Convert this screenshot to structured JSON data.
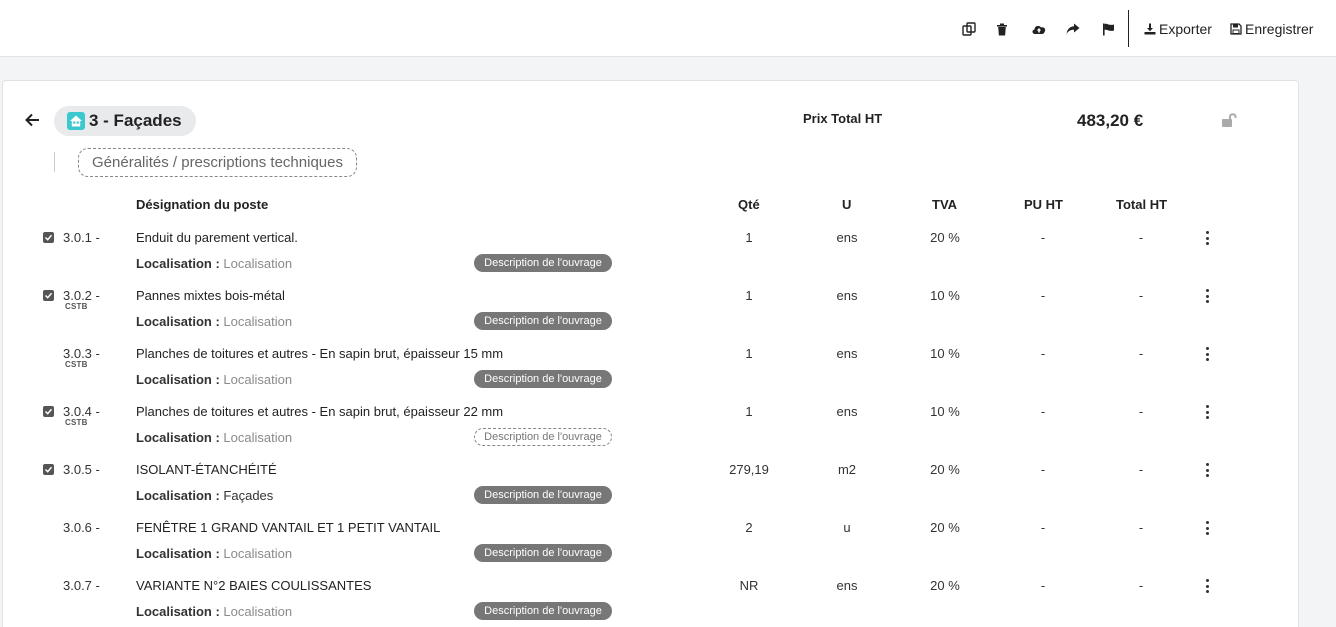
{
  "toolbar": {
    "icons": [
      "duplicate-icon",
      "trash-icon",
      "cloud-upload-icon",
      "share-icon",
      "flag-icon"
    ],
    "export_label": "Exporter",
    "save_label": "Enregistrer"
  },
  "header": {
    "section_title": "3 - Façades",
    "prix_label": "Prix Total HT",
    "prix_value": "483,20 €",
    "generalites_label": "Généralités / prescriptions techniques"
  },
  "table": {
    "headers": {
      "designation": "Désignation du poste",
      "qte": "Qté",
      "u": "U",
      "tva": "TVA",
      "pu_ht": "PU HT",
      "total_ht": "Total HT"
    },
    "localisation_label": "Localisation :",
    "description_label": "Description de l'ouvrage",
    "cstb_label": "CSTB",
    "rows": [
      {
        "num": "3.0.1 -",
        "checked": true,
        "cstb": false,
        "designation": "Enduit du parement vertical.",
        "localisation": "Localisation",
        "loc_filled": false,
        "desc_outline": false,
        "qte": "1",
        "u": "ens",
        "tva": "20 %",
        "pu_ht": "-",
        "total_ht": "-"
      },
      {
        "num": "3.0.2 -",
        "checked": true,
        "cstb": true,
        "designation": "Pannes mixtes bois-métal",
        "localisation": "Localisation",
        "loc_filled": false,
        "desc_outline": false,
        "qte": "1",
        "u": "ens",
        "tva": "10 %",
        "pu_ht": "-",
        "total_ht": "-"
      },
      {
        "num": "3.0.3 -",
        "checked": false,
        "cstb": true,
        "designation": "Planches de toitures et autres - En sapin brut, épaisseur 15 mm",
        "localisation": "Localisation",
        "loc_filled": false,
        "desc_outline": false,
        "qte": "1",
        "u": "ens",
        "tva": "10 %",
        "pu_ht": "-",
        "total_ht": "-"
      },
      {
        "num": "3.0.4 -",
        "checked": true,
        "cstb": true,
        "designation": "Planches de toitures et autres - En sapin brut, épaisseur 22 mm",
        "localisation": "Localisation",
        "loc_filled": false,
        "desc_outline": true,
        "qte": "1",
        "u": "ens",
        "tva": "10 %",
        "pu_ht": "-",
        "total_ht": "-"
      },
      {
        "num": "3.0.5 -",
        "checked": true,
        "cstb": false,
        "designation": "ISOLANT-ÉTANCHÉITÉ",
        "localisation": "Façades",
        "loc_filled": true,
        "desc_outline": false,
        "qte": "279,19",
        "u": "m2",
        "tva": "20 %",
        "pu_ht": "-",
        "total_ht": "-"
      },
      {
        "num": "3.0.6 -",
        "checked": false,
        "cstb": false,
        "designation": "FENÊTRE 1 GRAND VANTAIL ET 1 PETIT VANTAIL",
        "localisation": "Localisation",
        "loc_filled": false,
        "desc_outline": false,
        "qte": "2",
        "u": "u",
        "tva": "20 %",
        "pu_ht": "-",
        "total_ht": "-"
      },
      {
        "num": "3.0.7 -",
        "checked": false,
        "cstb": false,
        "designation": "VARIANTE N°2 BAIES COULISSANTES",
        "localisation": "Localisation",
        "loc_filled": false,
        "desc_outline": false,
        "qte": "NR",
        "u": "ens",
        "tva": "20 %",
        "pu_ht": "-",
        "total_ht": "-"
      }
    ]
  },
  "colors": {
    "accent": "#3cc8cf",
    "description_pill": "#777777"
  }
}
